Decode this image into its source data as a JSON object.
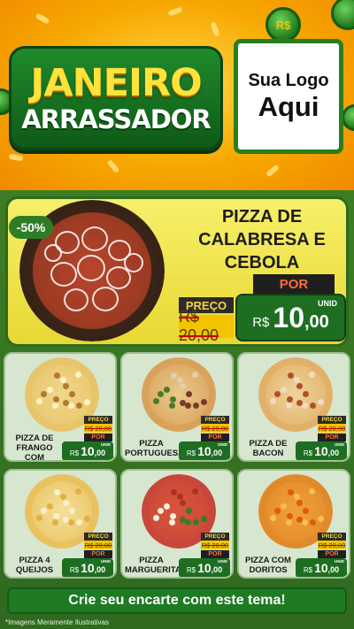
{
  "header": {
    "title_line1": "JANEIRO",
    "title_line2": "ARRASSADOR",
    "logo_line1": "Sua Logo",
    "logo_line2": "Aqui",
    "coin_symbol": "R$"
  },
  "featured": {
    "discount": "-50%",
    "name": "PIZZA DE CALABRESA E CEBOLA",
    "price_label": "PREÇO",
    "old_price": "R$ 20,00",
    "por_label": "POR",
    "currency": "R$",
    "new_price_int": "10",
    "new_price_cents": ",00",
    "unit": "UNID"
  },
  "products": [
    {
      "name": "PIZZA DE FRANGO COM CATUPIRY",
      "price_label": "PREÇO",
      "old_price": "R$ 20,00",
      "por_label": "POR",
      "currency": "R$",
      "price_int": "10",
      "price_cents": ",00",
      "unit": "UNID"
    },
    {
      "name": "PIZZA PORTUGUESA",
      "price_label": "PREÇO",
      "old_price": "R$ 20,00",
      "por_label": "POR",
      "currency": "R$",
      "price_int": "10",
      "price_cents": ",00",
      "unit": "UNID"
    },
    {
      "name": "PIZZA DE BACON",
      "price_label": "PREÇO",
      "old_price": "R$ 20,00",
      "por_label": "POR",
      "currency": "R$",
      "price_int": "10",
      "price_cents": ",00",
      "unit": "UNID"
    },
    {
      "name": "PIZZA 4 QUEIJOS",
      "price_label": "PREÇO",
      "old_price": "R$ 20,00",
      "por_label": "POR",
      "currency": "R$",
      "price_int": "10",
      "price_cents": ",00",
      "unit": "UNID"
    },
    {
      "name": "PIZZA MARGUERITA",
      "price_label": "PREÇO",
      "old_price": "R$ 20,00",
      "por_label": "POR",
      "currency": "R$",
      "price_int": "10",
      "price_cents": ",00",
      "unit": "UNID"
    },
    {
      "name": "PIZZA COM DORITOS",
      "price_label": "PREÇO",
      "old_price": "R$ 20,00",
      "por_label": "POR",
      "currency": "R$",
      "price_int": "10",
      "price_cents": ",00",
      "unit": "UNID"
    }
  ],
  "footer": {
    "cta": "Crie seu encarte com este tema!",
    "disclaimer": "*Imagens Meramente Ilustrativas"
  },
  "colors": {
    "brand_green": "#1e6e22",
    "accent_yellow": "#f6d43a",
    "price_red": "#ff6b3a",
    "header_orange": "#f7a800"
  }
}
